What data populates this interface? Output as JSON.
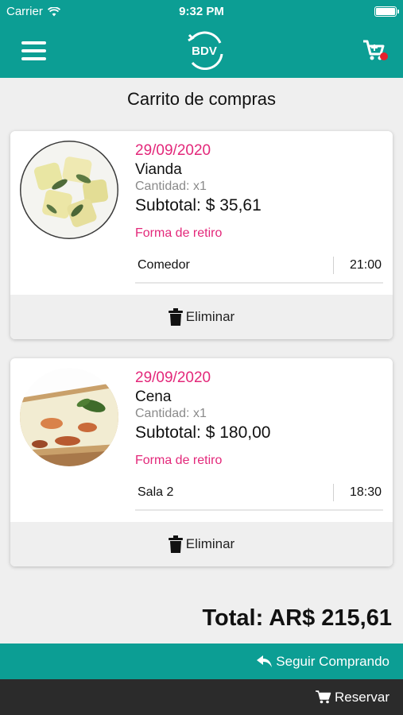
{
  "status_bar": {
    "carrier": "Carrier",
    "time": "9:32 PM"
  },
  "nav": {
    "logo_text": "BDV",
    "cart_badge_color": "#e8212b"
  },
  "page_title": "Carrito de compras",
  "items": [
    {
      "date": "29/09/2020",
      "name": "Vianda",
      "quantity": "Cantidad: x1",
      "subtotal": "Subtotal: $ 35,61",
      "pickup_label": "Forma de retiro",
      "pickup_place": "Comedor",
      "pickup_time": "21:00",
      "delete_label": "Eliminar",
      "image": "ravioli-with-sage"
    },
    {
      "date": "29/09/2020",
      "name": "Cena",
      "quantity": "Cantidad: x1",
      "subtotal": "Subtotal: $ 180,00",
      "pickup_label": "Forma de retiro",
      "pickup_place": "Sala 2",
      "pickup_time": "18:30",
      "delete_label": "Eliminar",
      "image": "pizza-slice-with-basil"
    }
  ],
  "total": "Total: AR$ 215,61",
  "actions": {
    "continue_label": "Seguir Comprando",
    "reserve_label": "Reservar"
  },
  "colors": {
    "primary": "#0c9e94",
    "accent": "#e3287a",
    "dark_bar": "#2b2b2b"
  }
}
